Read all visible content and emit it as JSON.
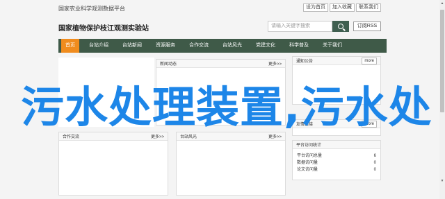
{
  "topbar": {
    "title": "国家农业科学观测数据平台",
    "links": [
      "设为首页",
      "加入收藏",
      "联系我们"
    ]
  },
  "header": {
    "site_title": "国家植物保护枝江观测实验站",
    "search_placeholder": "请输入关键字搜索",
    "subscribe_label": "订阅RSS"
  },
  "nav": {
    "items": [
      "首页",
      "台站介绍",
      "台站新闻",
      "资源服务",
      "合作交流",
      "台站风光",
      "党建文化",
      "科学普及",
      "关于我们"
    ],
    "active_index": 0
  },
  "panels": {
    "news": {
      "title": "新闻动态",
      "more": "更多>>"
    },
    "notice": {
      "title": "通知公告",
      "more": "more"
    },
    "cooperation": {
      "title": "合作交流",
      "more": "更多>>"
    },
    "scenery": {
      "title": "台站风光",
      "more": "更多>>"
    },
    "links": {
      "title": "友情链接",
      "more": "more"
    },
    "stats": {
      "title": "平台访问统计",
      "rows": [
        {
          "label": "平台访问总量",
          "value": "6"
        },
        {
          "label": "数据访问量",
          "value": "0"
        },
        {
          "label": "论文访问量",
          "value": "0"
        }
      ]
    }
  },
  "overlay_text": "污水处理装置,污水处",
  "colors": {
    "nav_bg": "#3f5a48",
    "nav_active": "#f08c1e",
    "overlay": "#1d86e8"
  }
}
